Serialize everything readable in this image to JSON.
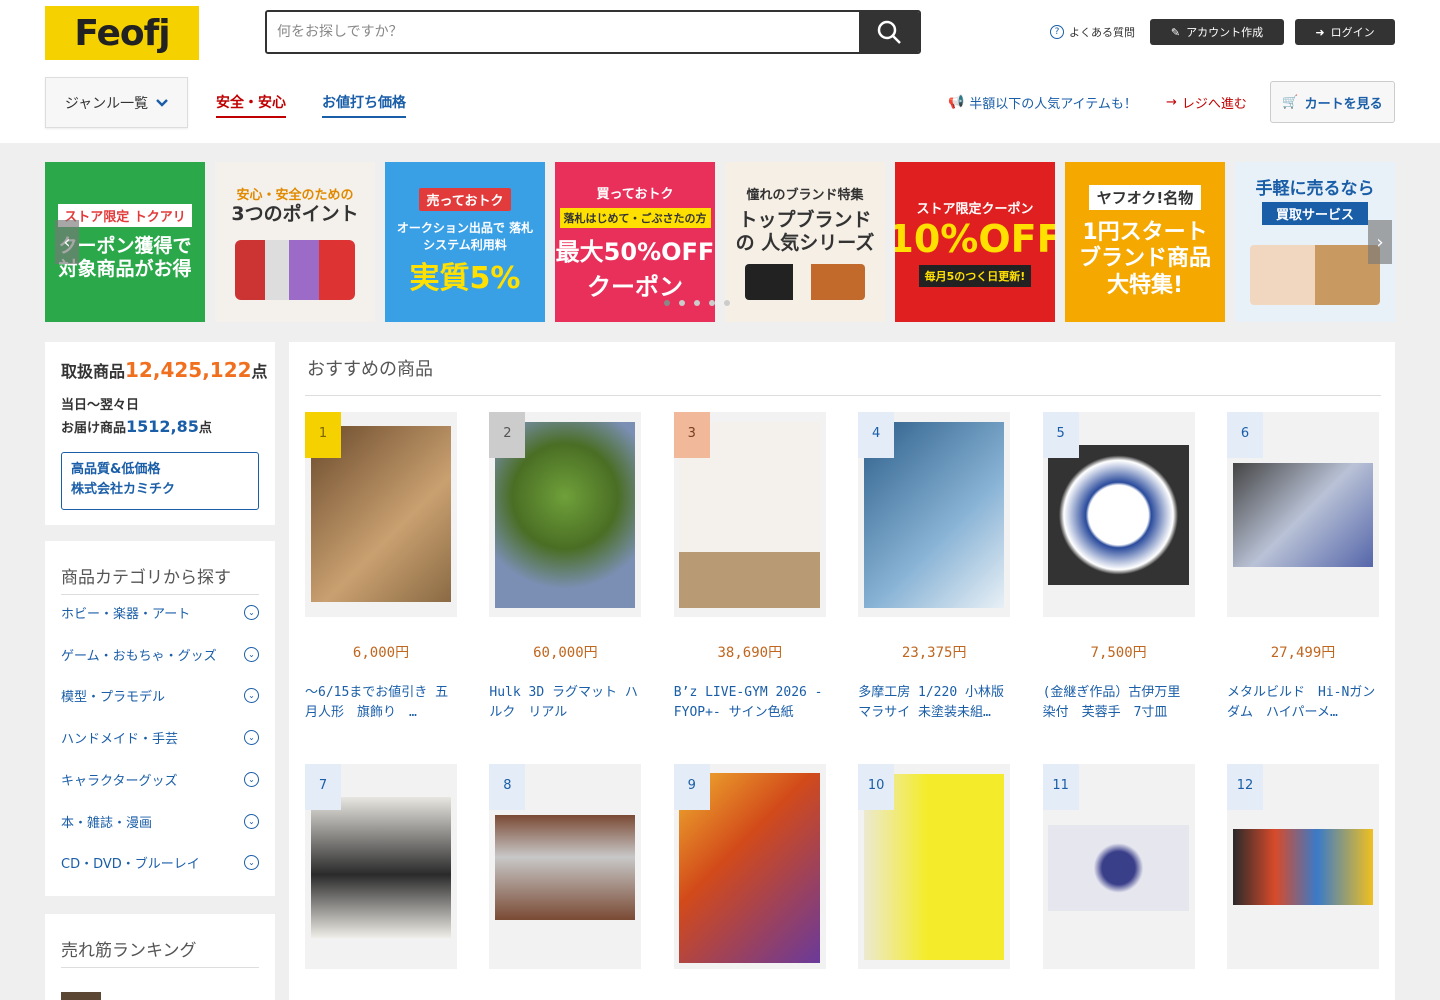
{
  "header": {
    "logo": "Feofj",
    "search_placeholder": "何をお探しですか？",
    "faq": "よくある質問",
    "create_account": "アカウント作成",
    "login": "ログイン"
  },
  "subnav": {
    "genre": "ジャンル一覧",
    "tab_safe": "安全・安心",
    "tab_price": "お値打ち価格",
    "promo": "半額以下の人気アイテムも！",
    "checkout": "レジへ進む",
    "cart": "カートを見る"
  },
  "banners": [
    {
      "l1": "ストア限定 トクアリ",
      "l2": "クーポン獲得で",
      "l3": "対象商品がお得"
    },
    {
      "l1": "安心・安全のための",
      "l2": "3つのポイント",
      "l3": ""
    },
    {
      "l1": "売っておトク",
      "l2": "オークション出品で 落札システム利用料",
      "l3": "実質5%"
    },
    {
      "l1": "買っておトク",
      "l2": "落札はじめて・ごぶさたの方",
      "l3": "最大50%OFF クーポン"
    },
    {
      "l1": "憧れのブランド特集",
      "l2": "トップブランドの 人気シリーズ",
      "l3": ""
    },
    {
      "l1": "ストア限定クーポン",
      "l2": "10%OFF",
      "l3": "毎月5のつく日更新!"
    },
    {
      "l1": "ヤフオク!名物",
      "l2": "1円スタート ブランド商品",
      "l3": "大特集!"
    },
    {
      "l1": "手軽に売るなら",
      "l2": "買取サービス",
      "l3": ""
    }
  ],
  "sidebar": {
    "count_label": "取扱商品",
    "count_value": "12,425,122",
    "count_unit": "点",
    "delivery_l1": "当日〜翌々日",
    "delivery_l2": "お届け商品",
    "delivery_value": "1512,85",
    "delivery_unit": "点",
    "kami_l1": "高品質&低価格",
    "kami_l2": "株式会社カミチク",
    "categories_title": "商品カテゴリから探す",
    "categories": [
      "ホビー・楽器・アート",
      "ゲーム・おもちゃ・グッズ",
      "模型・プラモデル",
      "ハンドメイド・手芸",
      "キャラクターグッズ",
      "本・雑誌・漫画",
      "CD・DVD・ブルーレイ"
    ],
    "ranking_title": "売れ筋ランキング"
  },
  "recommend": {
    "title": "おすすめの商品",
    "items": [
      {
        "rank": "1",
        "price": "6,000円",
        "name": "〜6/15までお値引き 五月人形　旗飾り　…"
      },
      {
        "rank": "2",
        "price": "60,000円",
        "name": "Hulk 3D ラグマット ハルク　リアル"
      },
      {
        "rank": "3",
        "price": "38,690円",
        "name": "B’z LIVE-GYM 2026 -FYOP+- サイン色紙"
      },
      {
        "rank": "4",
        "price": "23,375円",
        "name": "多摩工房 1/220 小林版 マラサイ 未塗装未組…"
      },
      {
        "rank": "5",
        "price": "7,500円",
        "name": "(金継ぎ作品）古伊万里 染付　芙蓉手　7寸皿"
      },
      {
        "rank": "6",
        "price": "27,499円",
        "name": "メタルビルド　Hi-Nガンダム　ハイパーメ…"
      },
      {
        "rank": "7",
        "price": "",
        "name": ""
      },
      {
        "rank": "8",
        "price": "",
        "name": ""
      },
      {
        "rank": "9",
        "price": "",
        "name": ""
      },
      {
        "rank": "10",
        "price": "",
        "name": ""
      },
      {
        "rank": "11",
        "price": "",
        "name": ""
      },
      {
        "rank": "12",
        "price": "",
        "name": ""
      }
    ]
  },
  "colors": {
    "accent": "#1a5ea8",
    "brand": "#f5d100",
    "price": "#c0661e",
    "alert": "#c00000"
  }
}
